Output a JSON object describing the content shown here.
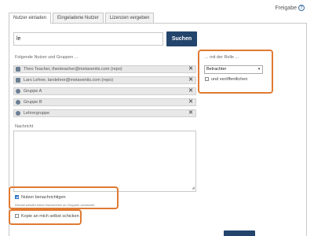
{
  "header": {
    "share_label": "Freigabe"
  },
  "tabs": [
    {
      "label": "Nutzer einladen"
    },
    {
      "label": "Eingeladene Nutzer"
    },
    {
      "label": "Lizenzen vergeben"
    }
  ],
  "search": {
    "value": "le",
    "button_label": "Suchen"
  },
  "selected": {
    "heading": "Folgende Nutzer und Gruppen ...",
    "items": [
      {
        "label": "Theo Teacher, theoteacher@metaventis.com (repo)",
        "type": "person"
      },
      {
        "label": "Lars Lehrer, larslehrer@metaventis.com (repo)",
        "type": "person"
      },
      {
        "label": "Gruppe A",
        "type": "group"
      },
      {
        "label": "Gruppe B",
        "type": "group"
      },
      {
        "label": "Lehrergruppe",
        "type": "group"
      }
    ]
  },
  "role": {
    "heading": "... mit der Rolle ...",
    "selected": "Betrachter",
    "publish_label": "und veröffentlichen",
    "publish_checked": false
  },
  "message": {
    "label": "Nachricht",
    "value": ""
  },
  "notify": {
    "label": "Nutzer benachrichtigen",
    "checked": true,
    "hint": "Derzeit werden keine Nachrichten an Gruppen versendet."
  },
  "copy": {
    "label": "Kopie an mich selbst schicken",
    "checked": false
  },
  "colors": {
    "primary": "#23456b",
    "highlight": "#e07a33",
    "accent": "#2a72c9"
  }
}
